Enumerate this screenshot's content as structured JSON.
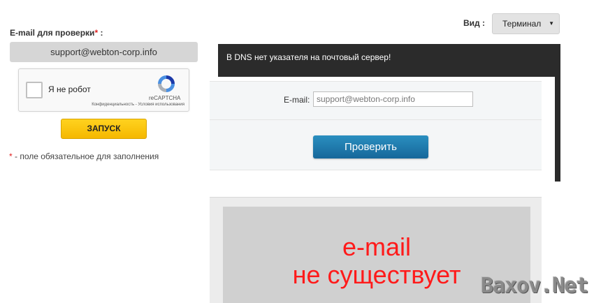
{
  "form": {
    "email_label": "E-mail для проверки",
    "required_mark": "*",
    "label_colon": " :",
    "email_value": "support@webton-corp.info",
    "captcha": {
      "checkbox_label": "Я не робот",
      "brand": "reCAPTCHA",
      "links": "Конфиденциальность - Условия использования",
      "icon": "recaptcha-icon"
    },
    "start_button": "ЗАПУСК",
    "required_note_mark": "*",
    "required_note_text": " - поле обязательное для заполнения"
  },
  "view": {
    "label": "Вид :",
    "selected": "Терминал",
    "caret": "▼"
  },
  "result": {
    "dns_message": "В DNS нет указателя на почтовый сервер!",
    "field_label": "E-mail:",
    "field_placeholder": "support@webton-corp.info",
    "check_button": "Проверить",
    "verdict_line1": "e-mail",
    "verdict_line2": "не существует"
  },
  "watermark": "Baxov.Net",
  "colors": {
    "accent_yellow": "#f5b800",
    "button_blue": "#1d7aad",
    "error_red": "#ff1a1a",
    "dark_bar": "#2b2b2b"
  }
}
